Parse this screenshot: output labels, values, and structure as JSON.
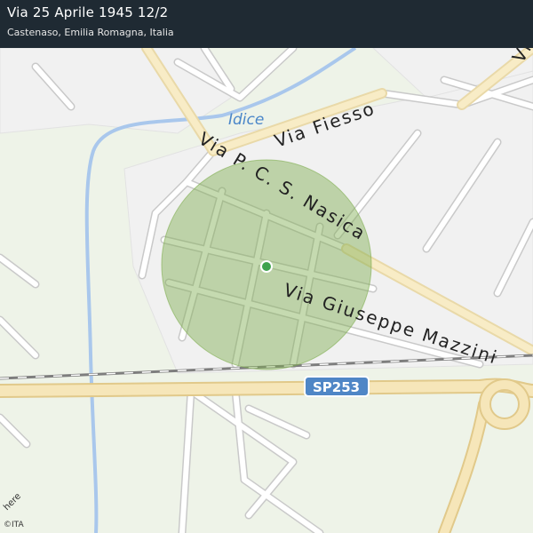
{
  "header": {
    "title": "Via 25 Aprile 1945 12/2",
    "subtitle": "Castenaso, Emilia Romagna, Italia"
  },
  "map": {
    "water_label": "Idice",
    "roads": {
      "via_fiesso": "Via  Fiesso",
      "via_nasica": "Via  P.  C.  S.  Nasica",
      "via_mazzini": "Via  Giuseppe  Mazzini",
      "partial_top_right": "Via"
    },
    "shield": "SP253",
    "colors": {
      "background": "#eef3e8",
      "block": "#f1f1f1",
      "road_casing": "#c9c9c9",
      "road_fill": "#ffffff",
      "highway_fill": "#f6e6b9",
      "water": "#a9c7ec",
      "accuracy_circle": "#7fae4f",
      "location_dot": "#3fa34d",
      "shield": "#4f86c6"
    }
  },
  "footer": {
    "logo_text": "here",
    "copyright": "©ITA"
  }
}
